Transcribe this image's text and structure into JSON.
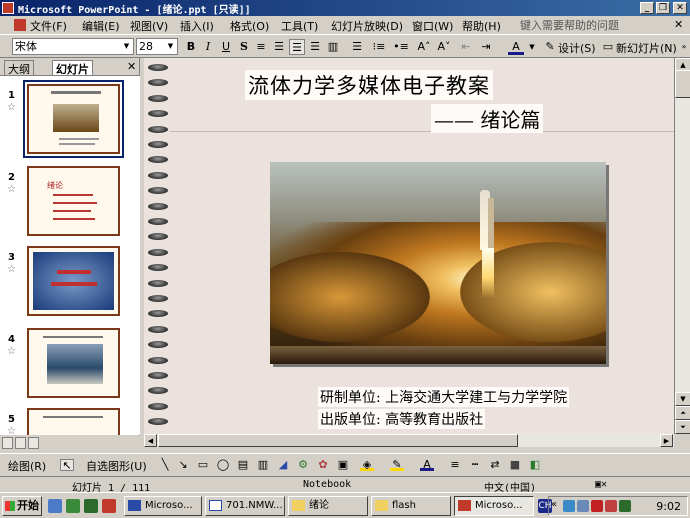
{
  "window": {
    "title": "Microsoft PowerPoint - [绪论.ppt [只读]]"
  },
  "menu": {
    "items": [
      "文件(F)",
      "编辑(E)",
      "视图(V)",
      "插入(I)",
      "格式(O)",
      "工具(T)",
      "幻灯片放映(D)",
      "窗口(W)",
      "帮助(H)"
    ],
    "help_prompt": "键入需要帮助的问题"
  },
  "format_toolbar": {
    "font": "宋体",
    "size": "28",
    "design_label": "设计(S)",
    "new_slide_label": "新幻灯片(N)"
  },
  "panel": {
    "tabs": [
      "大纲",
      "幻灯片"
    ],
    "active_tab": "幻灯片",
    "slides": [
      {
        "number": "1",
        "selected": true
      },
      {
        "number": "2",
        "selected": false,
        "text": "绪论"
      },
      {
        "number": "3",
        "selected": false
      },
      {
        "number": "4",
        "selected": false
      },
      {
        "number": "5",
        "selected": false
      }
    ]
  },
  "slide": {
    "title": "流体力学多媒体电子教案",
    "subtitle": "—— 绪论篇",
    "lines": [
      "研制单位: 上海交通大学建工与力学学院",
      "出版单位: 高等教育出版社"
    ]
  },
  "draw_toolbar": {
    "draw_label": "绘图(R)",
    "autoshapes_label": "自选图形(U)"
  },
  "status": {
    "slide_info": "幻灯片 1 / 111",
    "design": "Notebook",
    "language": "中文(中国)"
  },
  "taskbar": {
    "start_label": "开始",
    "tasks": [
      {
        "label": "Microso...",
        "active": false
      },
      {
        "label": "701.NMW...",
        "active": false
      },
      {
        "label": "绪论",
        "active": false
      },
      {
        "label": "flash",
        "active": false
      },
      {
        "label": "Microso...",
        "active": true
      }
    ],
    "clock": "9:02"
  }
}
